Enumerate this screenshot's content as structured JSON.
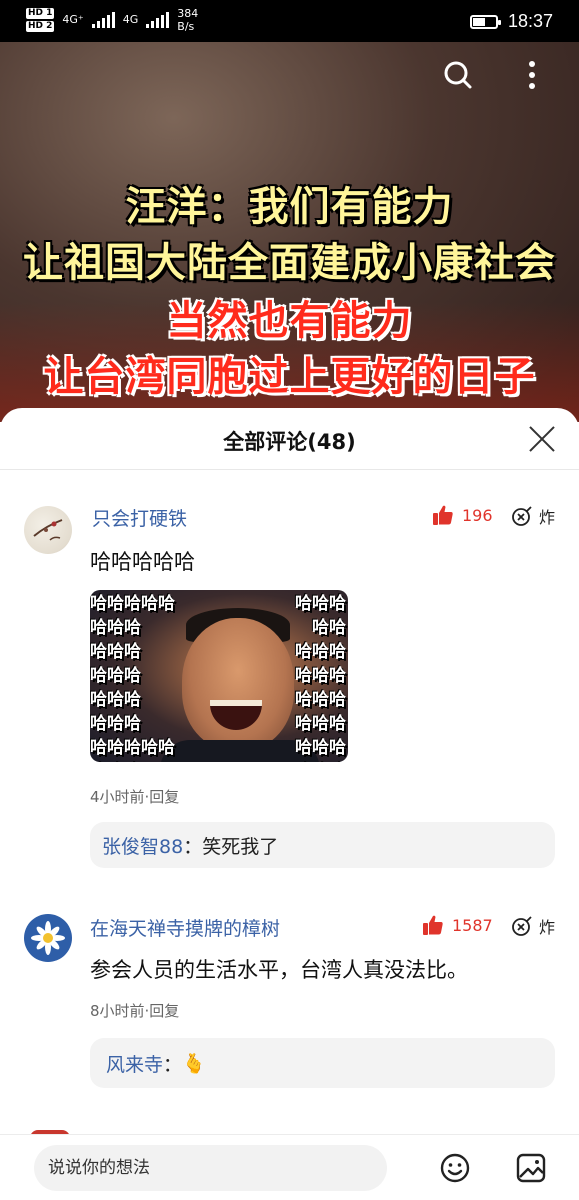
{
  "status": {
    "hd1": "HD 1",
    "hd2": "HD 2",
    "net1": "4G⁺",
    "net2": "4G",
    "speed_value": "384",
    "speed_unit": "B/s",
    "time": "18:37"
  },
  "video": {
    "caption_line1": "汪洋：我们有能力",
    "caption_line2": "让祖国大陆全面建成小康社会",
    "caption_line3": "当然也有能力",
    "caption_line4": "让台湾同胞过上更好的日子",
    "icons": [
      "search-icon",
      "more-vertical-icon"
    ]
  },
  "comments_panel": {
    "title": "全部评论(48)",
    "comments": [
      {
        "username": "只会打硬铁",
        "likes": "196",
        "boom_label": "炸",
        "text": "哈哈哈哈哈",
        "meme_left": "哈哈哈哈哈\n哈哈哈\n哈哈哈\n哈哈哈\n哈哈哈\n哈哈哈\n哈哈哈哈哈\n哈哈哈",
        "meme_right": "哈哈哈\n哈哈\n哈哈哈\n哈哈哈\n哈哈哈\n哈哈哈\n哈哈哈\n哈哈哈",
        "meta": "4小时前·回复",
        "reply_name": "张俊智88",
        "reply_sep": "：",
        "reply_text": "笑死我了"
      },
      {
        "username": "在海天禅寺摸牌的樟树",
        "likes": "1587",
        "boom_label": "炸",
        "text": "参会人员的生活水平，台湾人真没法比。",
        "meta": "8小时前·回复",
        "reply_name": "风来寺",
        "reply_sep": "：",
        "reply_emoji": "🫰"
      }
    ]
  },
  "bottom": {
    "input_placeholder": "说说你的想法",
    "icons": [
      "emoji-icon",
      "image-icon"
    ]
  },
  "colors": {
    "username": "#3b62a6",
    "like": "#e0342b",
    "caption_yellow": "#fff59a",
    "caption_red": "#ff2b1c"
  }
}
